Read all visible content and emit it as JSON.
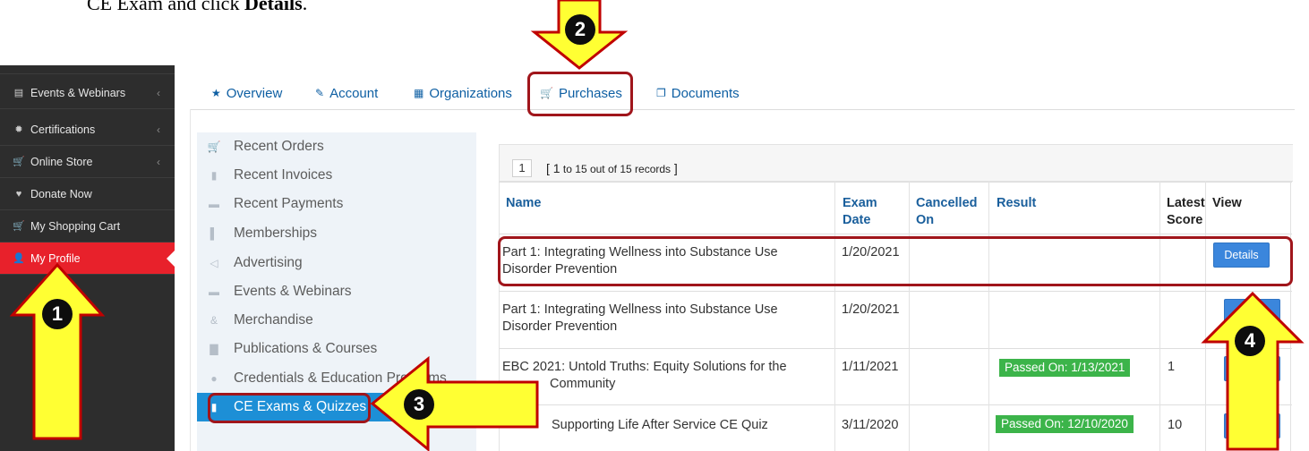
{
  "instruction": {
    "text": "CE Exam and click ",
    "bold": "Details",
    "end": "."
  },
  "sidebar": {
    "items": [
      {
        "label": "Events & Webinars",
        "icon": "calendar-icon",
        "has_chevron": true
      },
      {
        "label": "Certifications",
        "icon": "certificate-icon",
        "has_chevron": true
      },
      {
        "label": "Online Store",
        "icon": "cart-icon",
        "has_chevron": true
      },
      {
        "label": "Donate Now",
        "icon": "heart-icon",
        "has_chevron": false
      },
      {
        "label": "My Shopping Cart",
        "icon": "cart-icon",
        "has_chevron": false
      },
      {
        "label": "My Profile",
        "icon": "user-icon",
        "has_chevron": false,
        "active": true
      }
    ]
  },
  "tabs": [
    {
      "label": "Overview",
      "icon": "star-icon"
    },
    {
      "label": "Account",
      "icon": "edit-icon"
    },
    {
      "label": "Organizations",
      "icon": "building-icon"
    },
    {
      "label": "Purchases",
      "icon": "cart-icon",
      "highlighted": true
    },
    {
      "label": "Documents",
      "icon": "documents-icon"
    }
  ],
  "submenu": {
    "items": [
      {
        "label": "Recent Orders",
        "icon": "cart-icon"
      },
      {
        "label": "Recent Invoices",
        "icon": "clipboard-icon"
      },
      {
        "label": "Recent Payments",
        "icon": "money-icon"
      },
      {
        "label": "Memberships",
        "icon": "bookmark-icon"
      },
      {
        "label": "Advertising",
        "icon": "megaphone-icon"
      },
      {
        "label": "Events & Webinars",
        "icon": "ticket-icon"
      },
      {
        "label": "Merchandise",
        "icon": "shapes-icon"
      },
      {
        "label": "Publications & Courses",
        "icon": "book-icon"
      },
      {
        "label": "Credentials & Education Programs",
        "icon": "certificate-icon"
      },
      {
        "label": "CE Exams & Quizzes",
        "icon": "document-icon",
        "active": true
      }
    ]
  },
  "records": {
    "page": "1",
    "count_open": "[ ",
    "count_from": "1",
    "count_to_word": " to ",
    "count_to": "15",
    "count_outof": " out of ",
    "count_total": "15",
    "count_records": " records",
    "count_close": " ]"
  },
  "table": {
    "headers": {
      "name": "Name",
      "exam_date_1": "Exam",
      "exam_date_2": "Date",
      "cancelled_1": "Cancelled",
      "cancelled_2": "On",
      "result": "Result",
      "latest_1": "Latest",
      "latest_2": "Score",
      "view": "View"
    },
    "rows": [
      {
        "name_1": "Part 1: Integrating Wellness into Substance Use",
        "name_2": "Disorder Prevention",
        "exam_date": "1/20/2021",
        "cancelled": "",
        "result": "",
        "score": "",
        "view": "Details"
      },
      {
        "name_1": "Part 1: Integrating Wellness into Substance Use",
        "name_2": "Disorder Prevention",
        "exam_date": "1/20/2021",
        "cancelled": "",
        "result": "",
        "score": "",
        "view": ""
      },
      {
        "name_1": "EBC 2021: Untold Truths: Equity Solutions for the",
        "name_2": "Community",
        "exam_date": "1/11/2021",
        "cancelled": "",
        "result": "Passed On: 1/13/2021",
        "score": "1",
        "view": ""
      },
      {
        "name_1": "Supporting Life After Service CE Quiz",
        "name_2": "",
        "exam_date": "3/11/2020",
        "cancelled": "",
        "result": "Passed On: 12/10/2020",
        "score": "10",
        "view": ""
      }
    ]
  },
  "annotations": [
    {
      "number": "1",
      "target": "My Profile"
    },
    {
      "number": "2",
      "target": "Purchases"
    },
    {
      "number": "3",
      "target": "CE Exams & Quizzes"
    },
    {
      "number": "4",
      "target": "Details"
    }
  ],
  "colors": {
    "sidebar_bg": "#2d2d2d",
    "sidebar_active": "#e8212b",
    "link_blue": "#0e5fa3",
    "submenu_active": "#1d8fd6",
    "button_blue": "#3b86dc",
    "passed_green": "#3cb44a",
    "highlight_red": "#a0151b",
    "arrow_yellow": "#ffff33"
  }
}
